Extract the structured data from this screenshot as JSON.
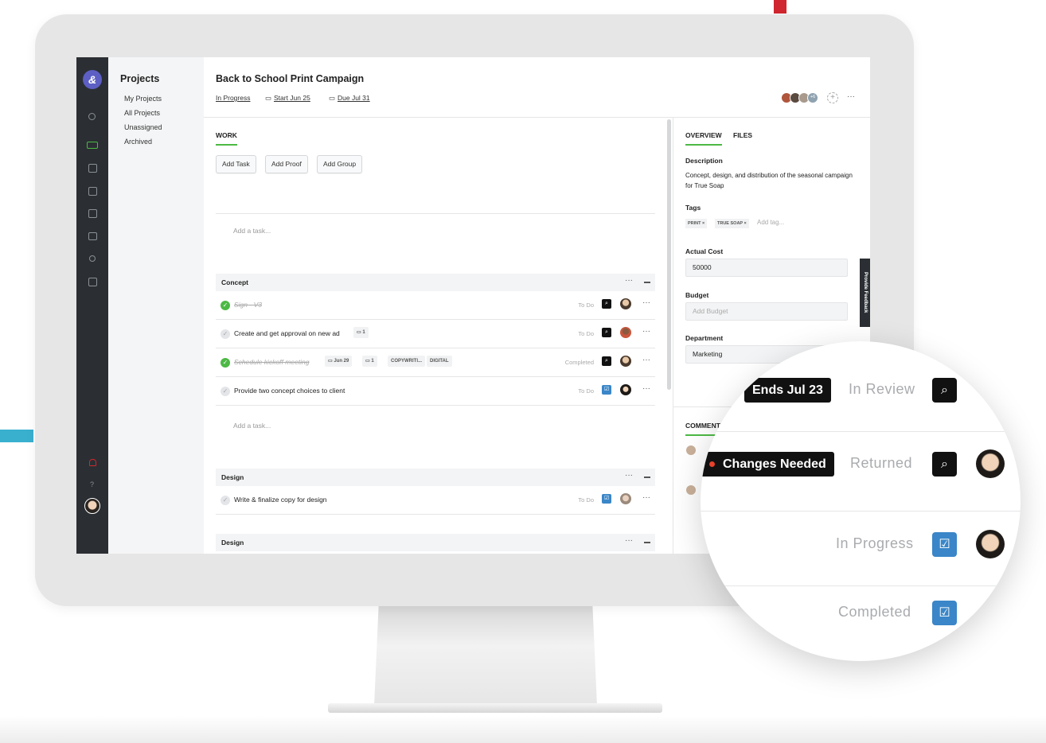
{
  "colors": {
    "accent": "#4cb944",
    "rail": "#2b2f33",
    "brand": "#5d5fc4",
    "proof_icon": "#111111",
    "task_icon": "#3a86c8",
    "changes_dot": "#e8412c"
  },
  "rail": {
    "logo": "&",
    "icons": [
      "search-icon",
      "folder-icon",
      "checkbox-icon",
      "inbox-icon",
      "proof-icon",
      "calendar-icon",
      "person-icon",
      "layout-icon",
      "bell-icon",
      "help-icon"
    ],
    "help": "?"
  },
  "projects": {
    "title": "Projects",
    "links": [
      "My Projects",
      "All Projects",
      "Unassigned",
      "Archived"
    ]
  },
  "header": {
    "title": "Back to School Print Campaign",
    "status": "In Progress",
    "start": "Start Jun 25",
    "due": "Due Jul 31",
    "extra_members": "+6",
    "more": "···"
  },
  "work": {
    "tab": "WORK",
    "buttons": [
      "Add Task",
      "Add Proof",
      "Add Group"
    ],
    "add_task_placeholder": "Add a task...",
    "groups": [
      {
        "name": "Concept",
        "tasks": [
          {
            "name": "Sign - V3",
            "done": true,
            "status": "To Do",
            "type": "proof"
          },
          {
            "name": "Create and get approval on new ad",
            "done": false,
            "comments": "1",
            "status": "To Do",
            "type": "proof"
          },
          {
            "name": "Schedule kickoff meeting",
            "done": true,
            "date": "Jun 29",
            "comments": "1",
            "tags": [
              "COPYWRITI...",
              "DIGITAL"
            ],
            "status": "Completed",
            "type": "proof"
          },
          {
            "name": "Provide two concept choices to client",
            "done": false,
            "status": "To Do",
            "type": "task"
          }
        ]
      },
      {
        "name": "Design",
        "tasks": [
          {
            "name": "Write & finalize copy for design",
            "done": false,
            "status": "To Do",
            "type": "task"
          }
        ]
      },
      {
        "name": "Design",
        "tasks": []
      }
    ]
  },
  "side": {
    "tabs": [
      "OVERVIEW",
      "FILES"
    ],
    "description_label": "Description",
    "description": "Concept, design, and distribution of the seasonal campaign for True Soap",
    "tags_label": "Tags",
    "tags": [
      "PRINT ×",
      "TRUE SOAP ×"
    ],
    "tag_placeholder": "Add tag...",
    "actual_cost_label": "Actual Cost",
    "actual_cost": "50000",
    "budget_label": "Budget",
    "budget_placeholder": "Add Budget",
    "department_label": "Department",
    "department": "Marketing",
    "comments_tab": "COMMENT",
    "feedback": "Provide Feedback"
  },
  "magnifier": {
    "rows": [
      {
        "pill": "Ends Jul 23",
        "status": "In Review",
        "type": "proof"
      },
      {
        "pill": "Changes Needed",
        "status": "Returned",
        "type": "proof"
      },
      {
        "status": "In Progress",
        "type": "task"
      },
      {
        "status": "Completed",
        "type": "task"
      }
    ]
  }
}
